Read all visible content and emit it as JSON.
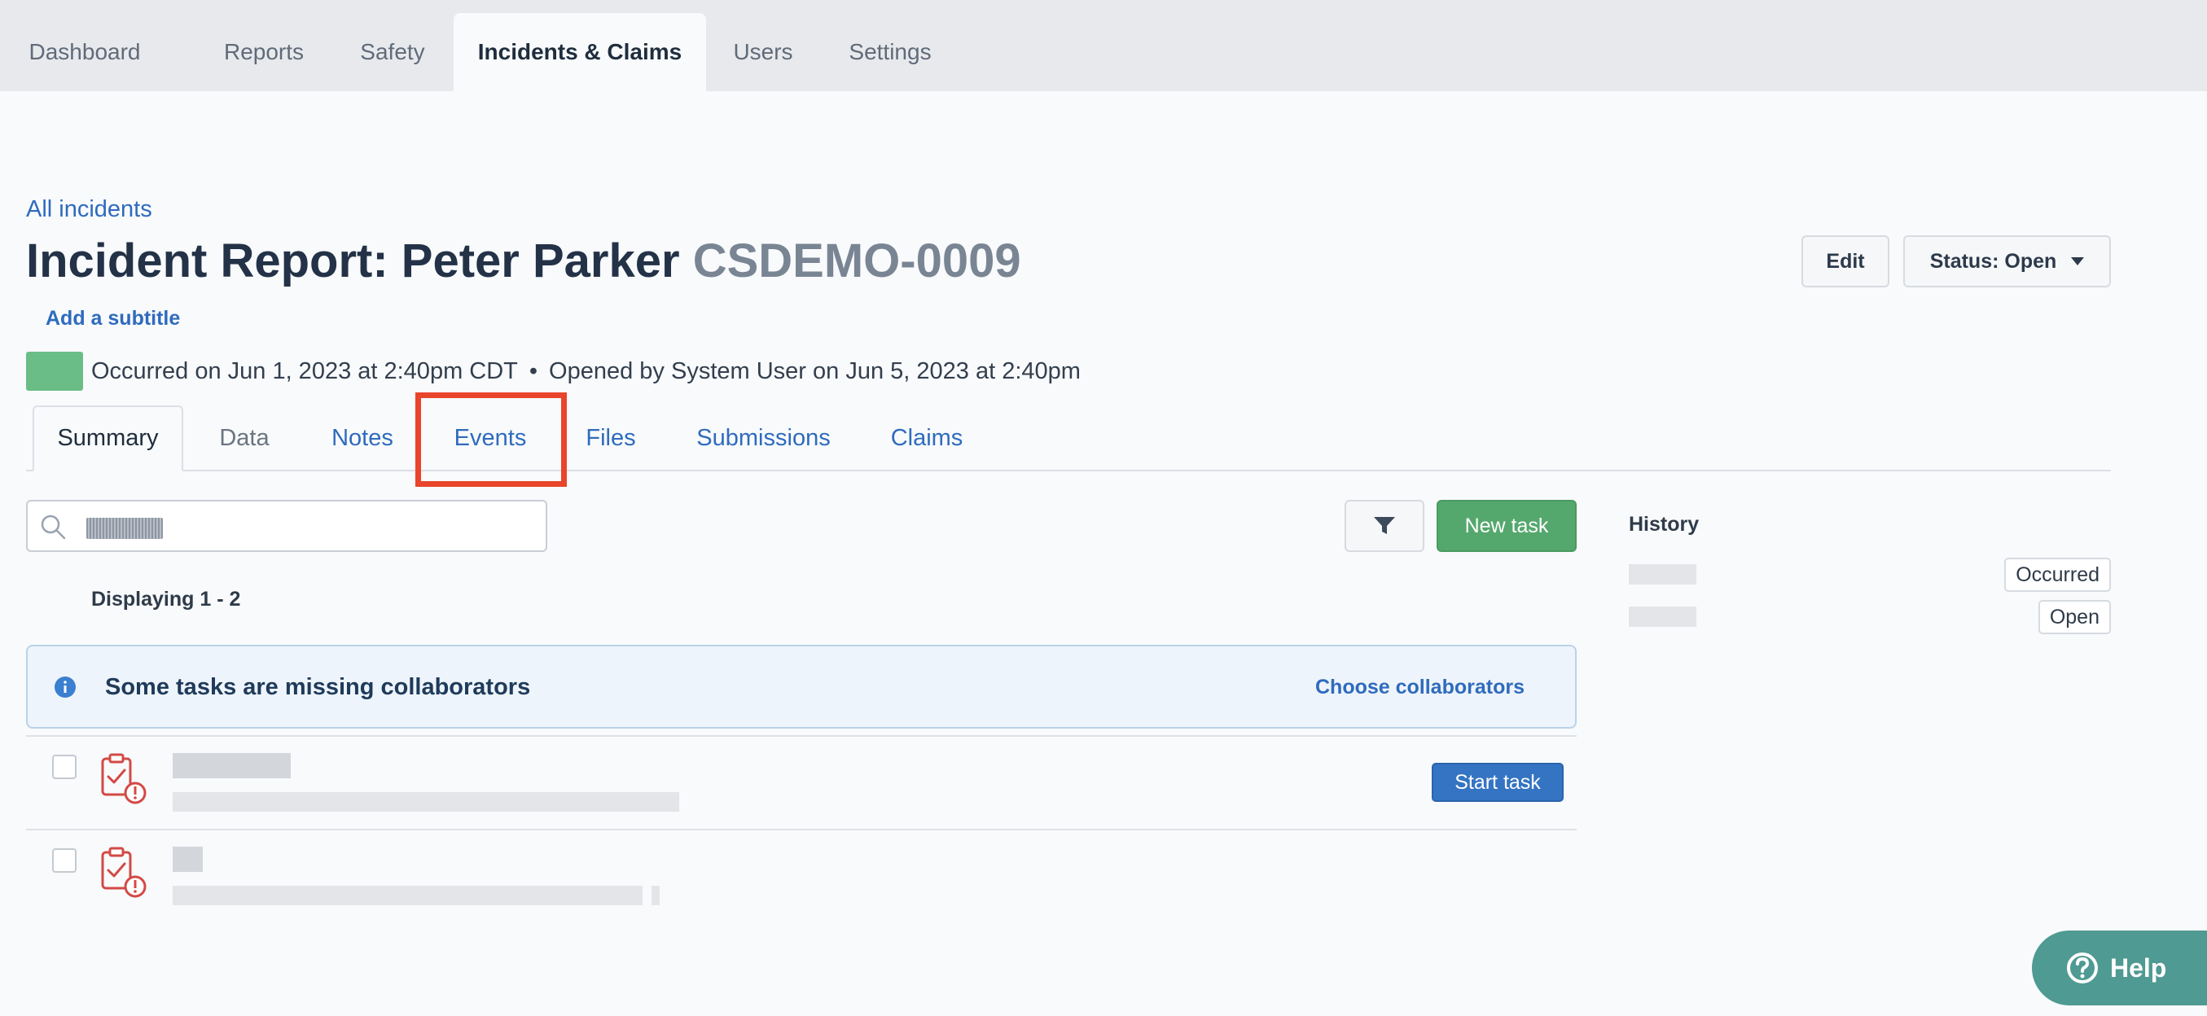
{
  "top_nav": {
    "tabs": [
      "Dashboard",
      "Reports",
      "Safety",
      "Incidents & Claims",
      "Users",
      "Settings"
    ],
    "active": "Incidents & Claims"
  },
  "breadcrumb": "All incidents",
  "page": {
    "title": "Incident Report: Peter Parker",
    "id": "CSDEMO-0009",
    "subtitle_link": "Add a subtitle",
    "occurred": "Occurred on Jun 1, 2023 at 2:40pm CDT",
    "separator": "•",
    "opened": "Opened by System User on Jun 5, 2023 at 2:40pm",
    "status_color": "#6abd86"
  },
  "actions": {
    "edit": "Edit",
    "status": "Status: Open"
  },
  "sub_tabs": {
    "items": [
      "Summary",
      "Data",
      "Notes",
      "Events",
      "Files",
      "Submissions",
      "Claims"
    ],
    "active": "Summary",
    "highlighted": "Events"
  },
  "tasks": {
    "search_placeholder": "",
    "new_task": "New task",
    "displaying": "Displaying 1 - 2",
    "alert_message": "Some tasks are missing collaborators",
    "alert_action": "Choose collaborators",
    "start_task": "Start task"
  },
  "history": {
    "title": "History",
    "badges": [
      "Occurred",
      "Open"
    ]
  },
  "help": "Help",
  "colors": {
    "accent_blue": "#2f6bbd",
    "success_green": "#55a86d",
    "highlight_red": "#e8452c",
    "help_teal": "#4f9a92"
  }
}
